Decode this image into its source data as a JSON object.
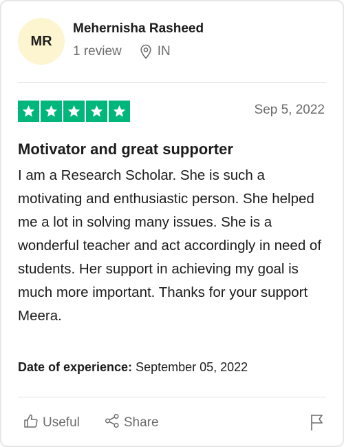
{
  "reviewer": {
    "initials": "MR",
    "name": "Mehernisha Rasheed",
    "review_count": "1 review",
    "country": "IN"
  },
  "review": {
    "rating": 5,
    "rating_max": 5,
    "date": "Sep 5, 2022",
    "title": "Motivator and great supporter",
    "body": "I am a Research Scholar. She is such a motivating and enthusiastic person. She helped me a lot in solving many issues. She is a wonderful teacher and act accordingly in need of students. Her support in achieving my goal is much more important. Thanks for your support Meera.",
    "experience_label": "Date of experience:",
    "experience_date": "September 05, 2022"
  },
  "actions": {
    "useful_label": "Useful",
    "share_label": "Share"
  },
  "colors": {
    "star_green": "#00b67a",
    "avatar_bg": "#fcf5cf",
    "muted_text": "#6b6b6b"
  },
  "icons": [
    "location-pin-icon",
    "star-icon",
    "thumbs-up-icon",
    "share-icon",
    "flag-icon"
  ]
}
